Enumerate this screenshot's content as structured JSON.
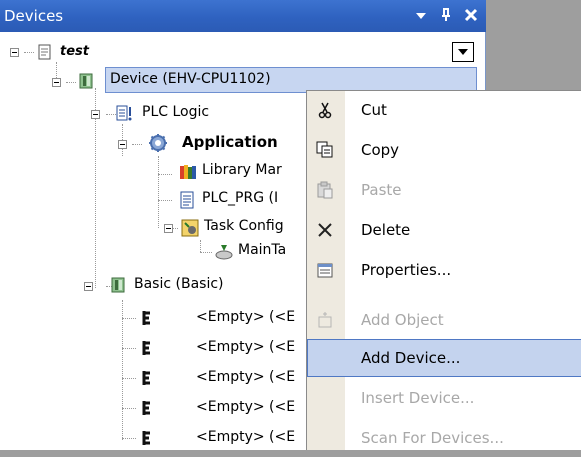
{
  "panel": {
    "title": "Devices",
    "buttons": {
      "dropdown": "▾",
      "pin": "ᵖ",
      "close": "✕"
    }
  },
  "tree": {
    "project": "test",
    "device": "Device (EHV-CPU1102)",
    "plc_logic": "PLC Logic",
    "application": "Application",
    "library_manager": "Library Mar",
    "plc_prg": "PLC_PRG (I",
    "task_config": "Task Config",
    "main_task": "MainTa",
    "basic": "Basic (Basic)",
    "empty_slots": [
      "<Empty> (<E",
      "<Empty> (<E",
      "<Empty> (<E",
      "<Empty> (<E",
      "<Empty> (<E"
    ]
  },
  "context_menu": {
    "items": [
      {
        "label": "Cut",
        "icon": "scissors-icon",
        "enabled": true
      },
      {
        "label": "Copy",
        "icon": "copy-icon",
        "enabled": true
      },
      {
        "label": "Paste",
        "icon": "paste-icon",
        "enabled": false
      },
      {
        "label": "Delete",
        "icon": "delete-icon",
        "enabled": true
      },
      {
        "label": "Properties...",
        "icon": "properties-icon",
        "enabled": true
      },
      {
        "label": "Add Object",
        "icon": "add-object-icon",
        "enabled": false
      },
      {
        "label": "Add Device...",
        "icon": "",
        "enabled": true,
        "highlighted": true
      },
      {
        "label": "Insert Device...",
        "icon": "",
        "enabled": false
      },
      {
        "label": "Scan For Devices...",
        "icon": "",
        "enabled": false
      }
    ]
  },
  "colors": {
    "titlebar": "#2f62c0",
    "selection": "#c7d6f1",
    "menu_highlight": "#c4d3ee",
    "disabled_text": "#a8a8a8"
  }
}
